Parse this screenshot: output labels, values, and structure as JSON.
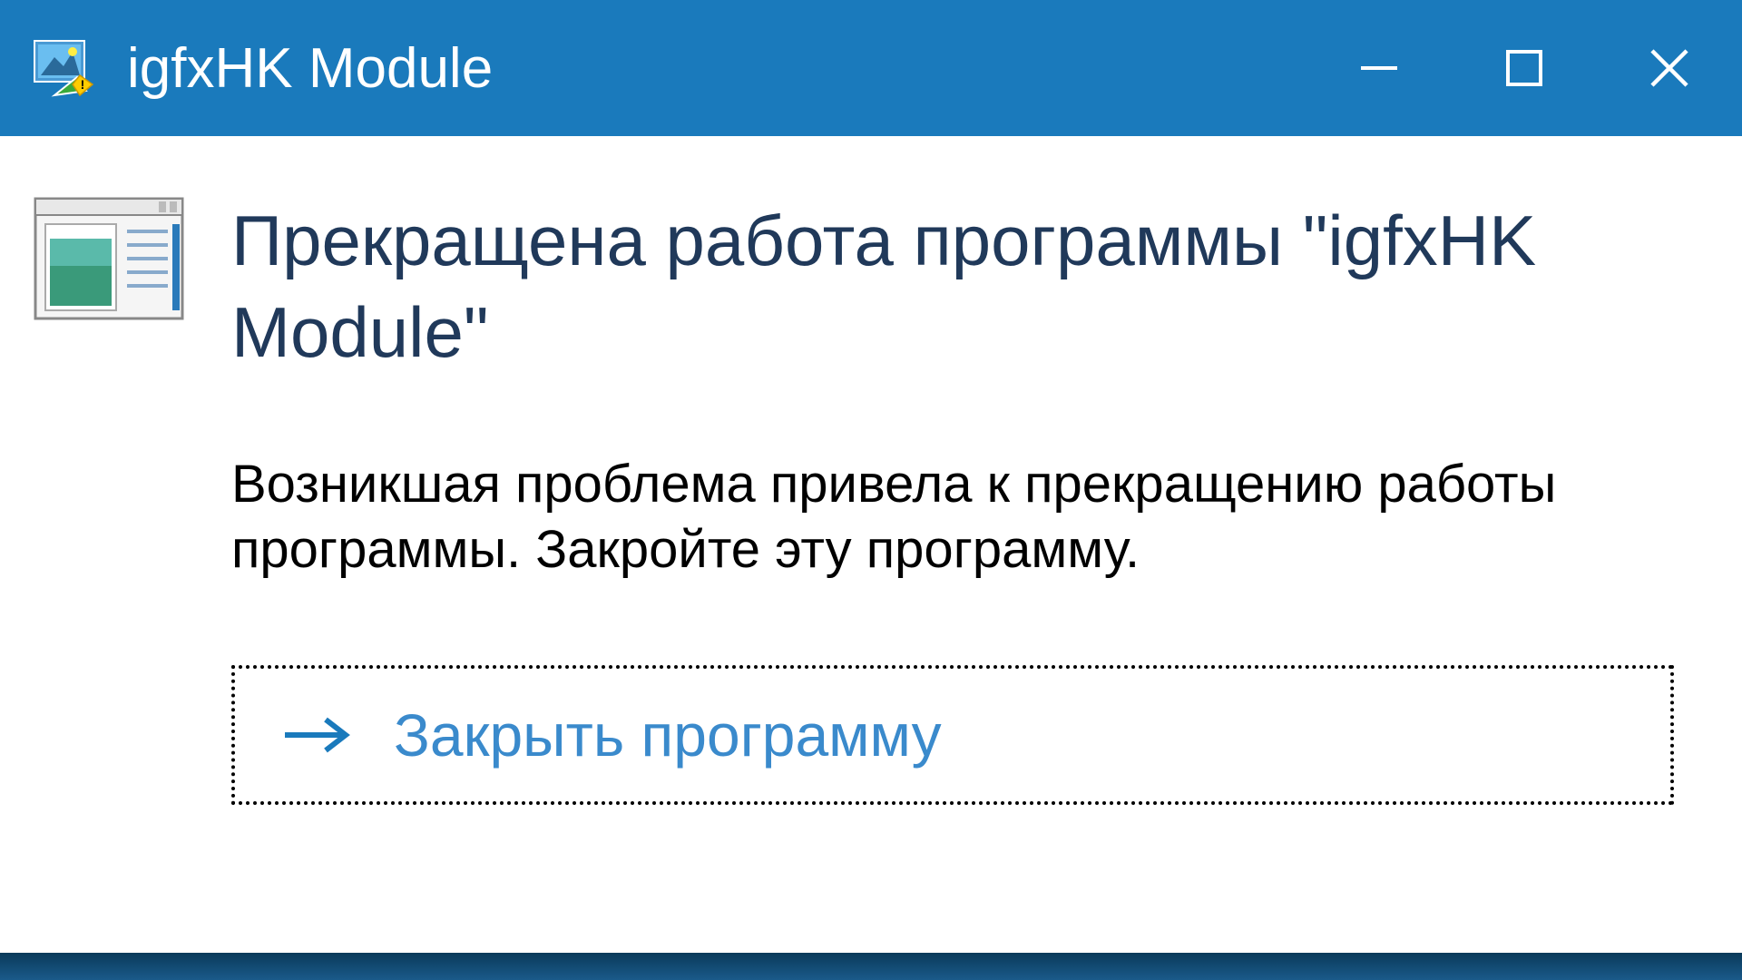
{
  "titlebar": {
    "title": "igfxHK Module"
  },
  "content": {
    "heading": "Прекращена работа программы \"igfxHK Module\"",
    "description": "Возникшая проблема привела к прекращению работы программы. Закройте эту программу."
  },
  "action": {
    "close_label": "Закрыть программу"
  },
  "colors": {
    "titlebar_bg": "#1a7abc",
    "heading_color": "#20395a",
    "action_color": "#3a8acc"
  }
}
